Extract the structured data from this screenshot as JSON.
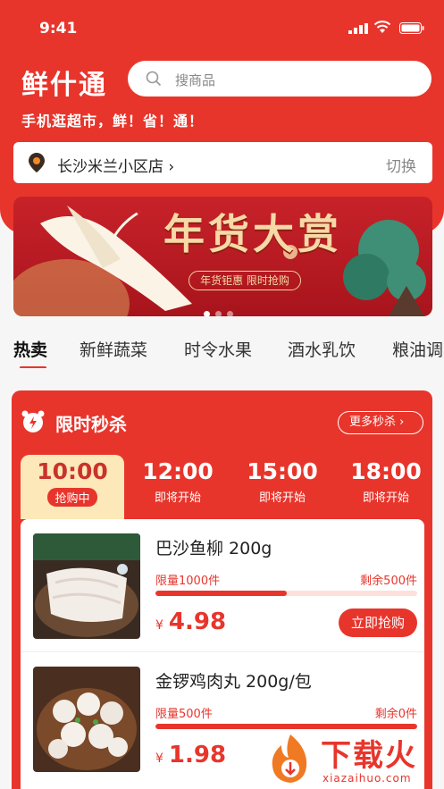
{
  "status_bar": {
    "time": "9:41"
  },
  "header": {
    "app_name": "鲜什通",
    "search_placeholder": "搜商品",
    "slogan": "手机逛超市，鲜！省！通！"
  },
  "store": {
    "name": "长沙米兰小区店 ›",
    "switch_label": "切换"
  },
  "banner": {
    "title": "年货大赏",
    "subtitle": "年货钜惠 限时抢购",
    "pages": 3,
    "active_page": 1
  },
  "categories": [
    "热卖",
    "新鲜蔬菜",
    "时令水果",
    "酒水乳饮",
    "粮油调"
  ],
  "active_category": 0,
  "flash_sale": {
    "title": "限时秒杀",
    "more_label": "更多秒杀 ›",
    "slots": [
      {
        "time": "10:00",
        "status": "抢购中"
      },
      {
        "time": "12:00",
        "status": "即将开始"
      },
      {
        "time": "15:00",
        "status": "即将开始"
      },
      {
        "time": "18:00",
        "status": "即将开始"
      }
    ],
    "items": [
      {
        "name": "巴沙鱼柳  200g",
        "limit": "限量1000件",
        "remaining": "剩余500件",
        "progress": 0.5,
        "currency": "¥",
        "price": "4.98",
        "buy_label": "立即抢购",
        "image": "fish-fillet"
      },
      {
        "name": "金锣鸡肉丸 200g/包",
        "limit": "限量500件",
        "remaining": "剩余0件",
        "progress": 1.0,
        "currency": "¥",
        "price": "1.98",
        "buy_label": "",
        "image": "meatballs"
      }
    ]
  },
  "watermark": {
    "text": "下载火",
    "url": "xiazaihuo.com"
  },
  "colors": {
    "primary": "#e8352c",
    "gold": "#f6d9a6",
    "slot_active": "#fde8b9"
  }
}
